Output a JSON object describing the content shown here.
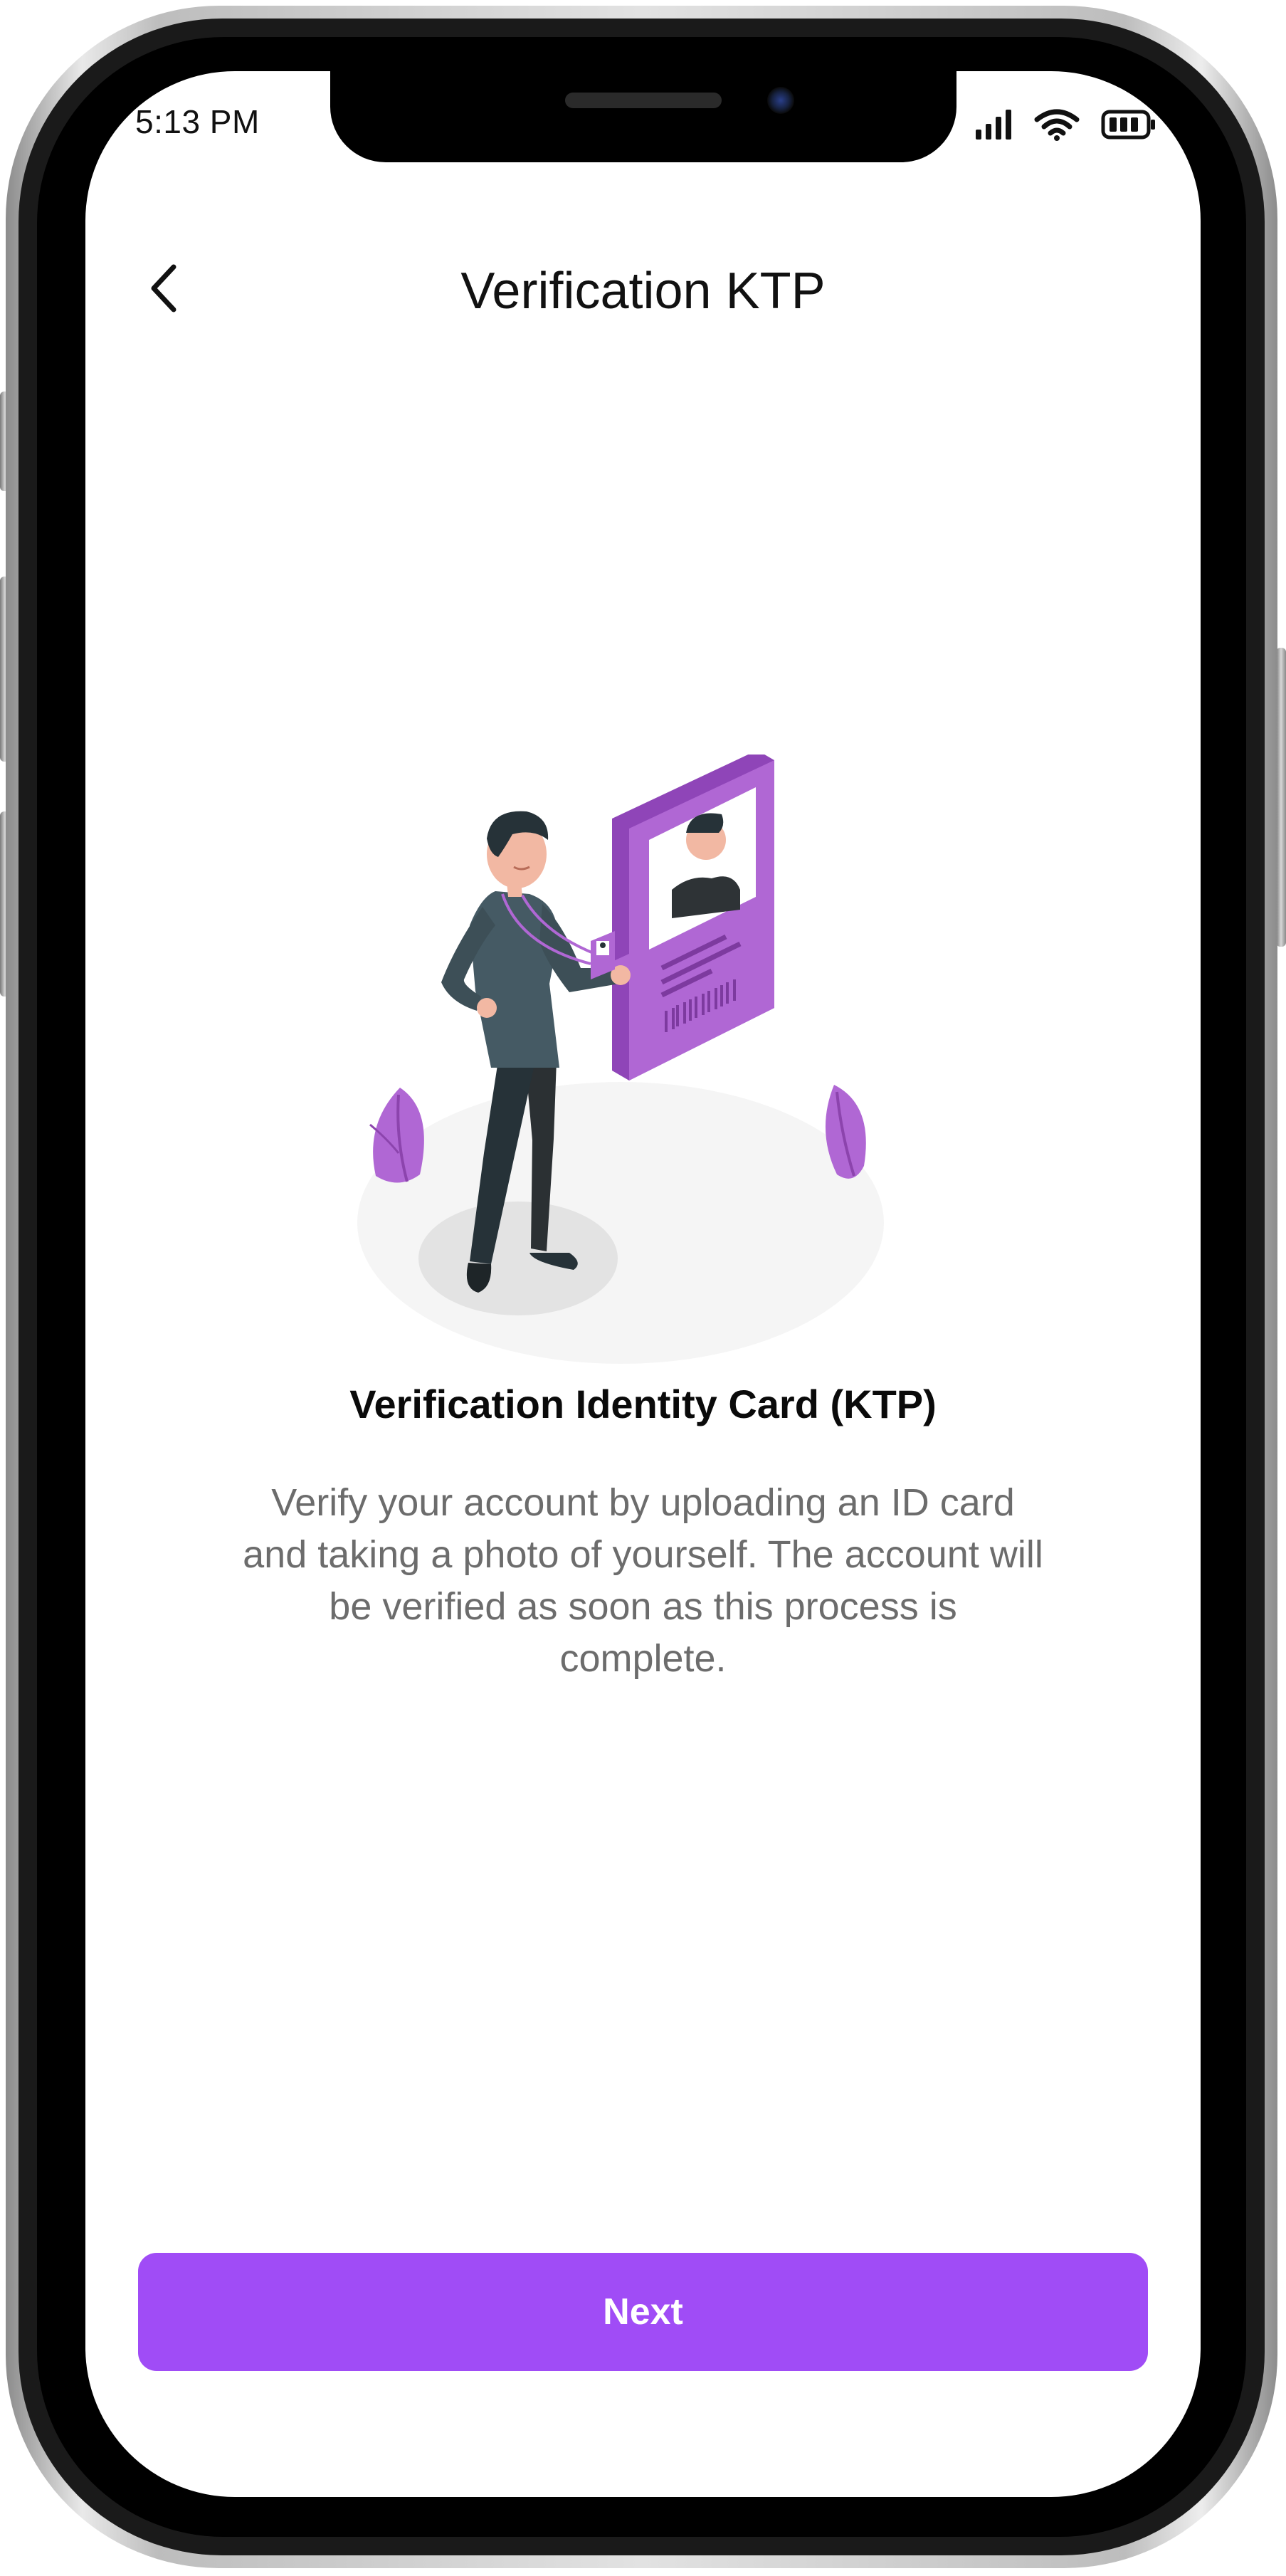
{
  "status_bar": {
    "time": "5:13 PM",
    "icons": [
      "cellular-signal-icon",
      "wifi-icon",
      "battery-icon"
    ]
  },
  "header": {
    "back_icon": "chevron-left-icon",
    "title": "Verification KTP"
  },
  "content": {
    "illustration": "id-card-verification-illustration",
    "title": "Verification Identity Card (KTP)",
    "description": "Verify your account by uploading an ID card and taking a photo of yourself. The account will be verified as soon as this process is complete."
  },
  "footer": {
    "next_label": "Next"
  },
  "colors": {
    "accent": "#a04cf6",
    "illustration_purple": "#b067d4",
    "title_text": "#111111",
    "body_text": "#6c6c6c"
  }
}
